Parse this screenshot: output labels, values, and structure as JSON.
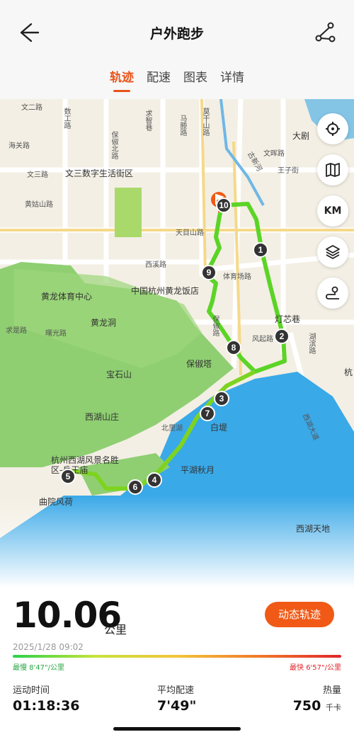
{
  "header": {
    "title": "户外跑步"
  },
  "tabs": [
    {
      "label": "轨迹",
      "active": true
    },
    {
      "label": "配速",
      "active": false
    },
    {
      "label": "图表",
      "active": false
    },
    {
      "label": "详情",
      "active": false
    }
  ],
  "map": {
    "places": [
      "文三数字生活街区",
      "黄龙体育中心",
      "中国杭州黄龙饭店",
      "黄龙洞",
      "宝石山",
      "保俶塔",
      "西湖山庄",
      "白堤",
      "平湖秋月",
      "杭州西湖风景名胜区-岳王庙",
      "曲院风荷",
      "西湖天地",
      "灯芯巷",
      "大剧",
      "杭"
    ],
    "roads": [
      "文二路",
      "数工路",
      "求智巷",
      "马塍路",
      "莫干山路",
      "古新河",
      "海关路",
      "保俶北路",
      "文三路",
      "文晖路",
      "王子街",
      "黄姑山路",
      "天目山路",
      "西溪路",
      "体育场路",
      "求是路",
      "曙光路",
      "保俶路",
      "风起路",
      "北里湖",
      "西湖大道",
      "湖滨路"
    ],
    "route_markers": [
      "10",
      "1",
      "2",
      "3",
      "4",
      "5",
      "6",
      "7",
      "8",
      "9"
    ],
    "tools": [
      {
        "icon": "locate-icon"
      },
      {
        "icon": "map-icon"
      },
      {
        "label": "KM"
      },
      {
        "icon": "layers-icon"
      },
      {
        "icon": "route-icon"
      }
    ]
  },
  "summary": {
    "distance": "10.06",
    "distance_unit": "公里",
    "dynamic_track_button": "动态轨迹",
    "date": "2025/1/28 09:02",
    "slowest_label": "最慢 8'47\"/公里",
    "fastest_label": "最快 6'57\"/公里",
    "duration_label": "运动时间",
    "duration_value": "01:18:36",
    "pace_label": "平均配速",
    "pace_value": "7'49\"",
    "calories_label": "热量",
    "calories_value": "750",
    "calories_unit": "千卡"
  },
  "colors": {
    "accent": "#f05a16",
    "route": "#58d826",
    "lake": "#3aa9e8"
  }
}
